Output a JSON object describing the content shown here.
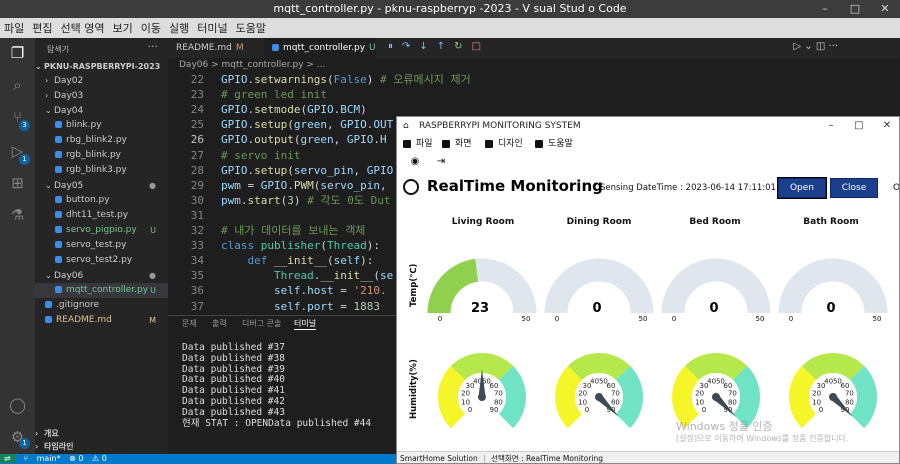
{
  "vscode": {
    "title": "mqtt_controller.py - pknu-raspberryp -2023 - V sual Stud o Code",
    "menu": [
      "파일",
      "편집",
      "선택 영역",
      "보기",
      "이동",
      "실행",
      "터미널",
      "도움말"
    ],
    "explorer_title": "탐색기",
    "workspace": "PKNU-RASPBERRYPI-2023",
    "tree": [
      {
        "label": "Day02",
        "type": "folder",
        "indent": 1,
        "mark": ""
      },
      {
        "label": "Day03",
        "type": "folder",
        "indent": 1,
        "mark": ""
      },
      {
        "label": "Day04",
        "type": "folder",
        "indent": 1,
        "mark": "",
        "open": true
      },
      {
        "label": "blink.py",
        "type": "file",
        "indent": 2,
        "mark": ""
      },
      {
        "label": "rbg_blink2.py",
        "type": "file",
        "indent": 2,
        "mark": ""
      },
      {
        "label": "rgb_blink.py",
        "type": "file",
        "indent": 2,
        "mark": ""
      },
      {
        "label": "rgb_blink3.py",
        "type": "file",
        "indent": 2,
        "mark": ""
      },
      {
        "label": "Day05",
        "type": "folder",
        "indent": 1,
        "mark": "●",
        "open": true
      },
      {
        "label": "button.py",
        "type": "file",
        "indent": 2,
        "mark": ""
      },
      {
        "label": "dht11_test.py",
        "type": "file",
        "indent": 2,
        "mark": ""
      },
      {
        "label": "servo_pigpio.py",
        "type": "file",
        "indent": 2,
        "mark": "U"
      },
      {
        "label": "servo_test.py",
        "type": "file",
        "indent": 2,
        "mark": ""
      },
      {
        "label": "servo_test2.py",
        "type": "file",
        "indent": 2,
        "mark": ""
      },
      {
        "label": "Day06",
        "type": "folder",
        "indent": 1,
        "mark": "●",
        "open": true
      },
      {
        "label": "mqtt_controller.py",
        "type": "file",
        "indent": 2,
        "mark": "U",
        "selected": true
      },
      {
        "label": ".gitignore",
        "type": "file",
        "indent": 1,
        "mark": ""
      },
      {
        "label": "README.md",
        "type": "file",
        "indent": 1,
        "mark": "M"
      }
    ],
    "outline_label": "개요",
    "timeline_label": "타임라인",
    "tabs": [
      {
        "label": "README.md",
        "mark": "M"
      },
      {
        "label": "mqtt_controller.py",
        "mark": "U"
      }
    ],
    "breadcrumb": "Day06 > mqtt_controller.py > ...",
    "code": [
      {
        "n": "22",
        "html": "<span class='id'>GPIO</span><span class='pl'>.</span><span class='fn'>setwarnings</span><span class='pl'>(</span><span class='kw'>False</span><span class='pl'>) </span><span class='cm'># 오류메시지 제거</span>"
      },
      {
        "n": "23",
        "html": "<span class='cm'># green led init</span>"
      },
      {
        "n": "24",
        "html": "<span class='id'>GPIO</span><span class='pl'>.</span><span class='fn'>setmode</span><span class='pl'>(</span><span class='id'>GPIO</span><span class='pl'>.</span><span class='id'>BCM</span><span class='pl'>)</span>"
      },
      {
        "n": "25",
        "html": "<span class='id'>GPIO</span><span class='pl'>.</span><span class='fn'>setup</span><span class='pl'>(</span><span class='id'>green</span><span class='pl'>, </span><span class='id'>GPIO</span><span class='pl'>.</span><span class='id'>OUT</span>"
      },
      {
        "n": "26",
        "html": "<span class='id'>GPIO</span><span class='pl'>.</span><span class='fn'>output</span><span class='pl'>(</span><span class='id'>green</span><span class='pl'>, </span><span class='id'>GPIO</span><span class='pl'>.</span><span class='id'>H</span>",
        "current": true
      },
      {
        "n": "27",
        "html": "<span class='cm'># servo init</span>"
      },
      {
        "n": "28",
        "html": "<span class='id'>GPIO</span><span class='pl'>.</span><span class='fn'>setup</span><span class='pl'>(</span><span class='id'>servo_pin</span><span class='pl'>, </span><span class='id'>GPIO</span>"
      },
      {
        "n": "29",
        "html": "<span class='id'>pwm</span><span class='pl'> = </span><span class='id'>GPIO</span><span class='pl'>.</span><span class='fn'>PWM</span><span class='pl'>(</span><span class='id'>servo_pin</span><span class='pl'>,</span>"
      },
      {
        "n": "30",
        "html": "<span class='id'>pwm</span><span class='pl'>.</span><span class='fn'>start</span><span class='pl'>(</span><span class='num'>3</span><span class='pl'>) </span><span class='cm'># 각도 0도 Dut</span>"
      },
      {
        "n": "31",
        "html": ""
      },
      {
        "n": "32",
        "html": "<span class='cm'># 내가 데이터를 보내는 객체</span>"
      },
      {
        "n": "33",
        "html": "<span class='kw'>class</span><span class='pl'> </span><span class='cls'>publisher</span><span class='pl'>(</span><span class='cls'>Thread</span><span class='pl'>):</span>"
      },
      {
        "n": "34",
        "html": "<span class='pl'>    </span><span class='kw'>def</span><span class='pl'> </span><span class='fn'>__init__</span><span class='pl'>(</span><span class='id'>self</span><span class='pl'>):</span>"
      },
      {
        "n": "35",
        "html": "<span class='pl'>        </span><span class='cls'>Thread</span><span class='pl'>.</span><span class='fn'>__init__</span><span class='pl'>(</span><span class='id'>se</span>"
      },
      {
        "n": "36",
        "html": "<span class='pl'>        </span><span class='id'>self</span><span class='pl'>.</span><span class='id'>host</span><span class='pl'> = </span><span class='str'>'210.</span>"
      },
      {
        "n": "37",
        "html": "<span class='pl'>        </span><span class='id'>self</span><span class='pl'>.</span><span class='id'>port</span><span class='pl'> = </span><span class='num'>1883</span>"
      }
    ],
    "panel_tabs": [
      "문제",
      "출력",
      "디버그 콘솔",
      "터미널"
    ],
    "terminal": [
      "Data published #37",
      "Data published #38",
      "Data published #39",
      "Data published #40",
      "Data published #41",
      "Data published #42",
      "Data published #43",
      "현재 STAT : OPENData published #44"
    ],
    "status": {
      "branch": "main*",
      "errors": "⊗ 0",
      "warnings": "⚠ 0"
    },
    "watermark": "Windows 정품 인증",
    "watermark_sub": "[설정]으로 이동하여 Windows를 정품 인증합니다."
  },
  "app": {
    "title": "RASPBERRYPI MONITORING SYSTEM",
    "menu": [
      "파일",
      "화면",
      "디자인",
      "도움말"
    ],
    "header_title": "RealTime Monitoring",
    "sensing": "Sensing DateTime : 2023-06-14 17:11:01",
    "open_label": "Open",
    "close_label": "Close",
    "trunc_label": "O",
    "rooms": [
      "Living Room",
      "Dining Room",
      "Bed Room",
      "Bath Room"
    ],
    "temp_axis_label": "Temp(℃)",
    "humid_axis_label": "Humidity(%)",
    "temp_values": [
      23,
      0,
      0,
      0
    ],
    "temp_range": [
      0,
      50
    ],
    "humid_values": [
      45,
      90,
      90,
      90
    ],
    "humid_range": [
      0,
      90
    ],
    "humid_ticks": [
      0,
      10,
      20,
      30,
      40,
      50,
      60,
      70,
      80,
      90
    ],
    "status_left": "SmartHome Solution",
    "status_right": "선택화면 : RealTime Monitoring",
    "colors": {
      "gauge_bg": "#dfe6ee",
      "temp_fill": "#8fd14f",
      "humid_yellow": "#f6f52a",
      "humid_green": "#b5e94b",
      "humid_teal": "#6fe3c4",
      "needle": "#3c4a55"
    }
  }
}
